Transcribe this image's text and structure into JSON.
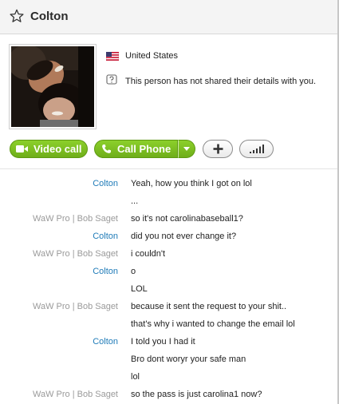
{
  "header": {
    "title": "Colton",
    "star_icon": "star-outline-icon"
  },
  "profile": {
    "country": "United States",
    "privacy_note": "This person has not shared their details with you."
  },
  "actions": {
    "video_call_label": "Video call",
    "call_phone_label": "Call Phone"
  },
  "colors": {
    "accent_green": "#7ac142",
    "sender_self": "#1f7bb8",
    "sender_other": "#9a9a9a"
  },
  "messages": [
    {
      "sender": "Colton",
      "text": "Yeah, how you think I got on lol",
      "who": "colton"
    },
    {
      "sender": "",
      "text": "...",
      "who": "colton"
    },
    {
      "sender": "WaW Pro | Bob Saget",
      "text": "so it's not carolinabaseball1?",
      "who": "waw"
    },
    {
      "sender": "Colton",
      "text": "did you not ever change it?",
      "who": "colton"
    },
    {
      "sender": "WaW Pro | Bob Saget",
      "text": "i couldn't",
      "who": "waw"
    },
    {
      "sender": "Colton",
      "text": "o",
      "who": "colton"
    },
    {
      "sender": "",
      "text": "LOL",
      "who": "colton"
    },
    {
      "sender": "WaW Pro | Bob Saget",
      "text": "because it sent the request to your shit..",
      "who": "waw"
    },
    {
      "sender": "",
      "text": "that's why i wanted to change the email lol",
      "who": "waw"
    },
    {
      "sender": "Colton",
      "text": "I told you I had it",
      "who": "colton"
    },
    {
      "sender": "",
      "text": "Bro dont woryr your safe man",
      "who": "colton"
    },
    {
      "sender": "",
      "text": "lol",
      "who": "colton"
    },
    {
      "sender": "WaW Pro | Bob Saget",
      "text": "so the pass is just carolina1 now?",
      "who": "waw"
    }
  ]
}
